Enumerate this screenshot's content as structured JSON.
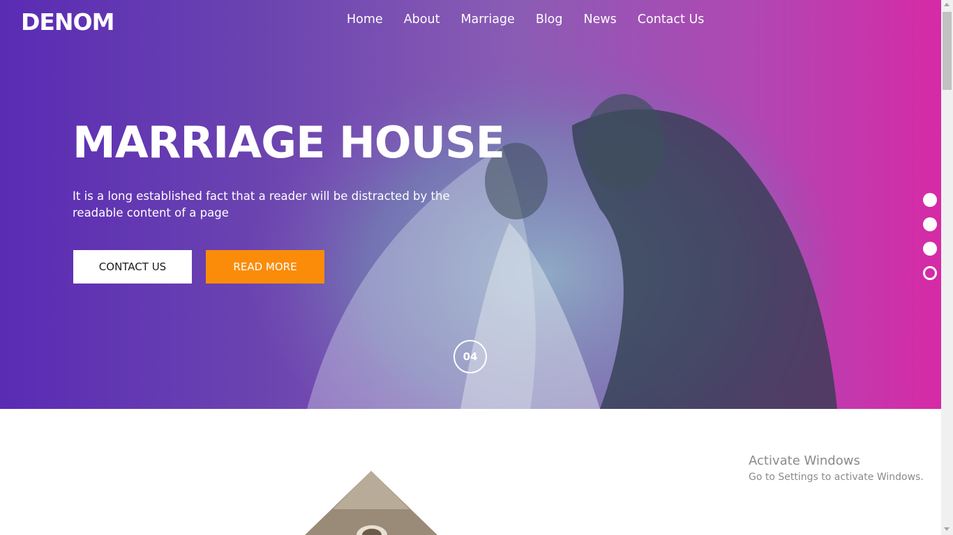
{
  "brand": {
    "logo": "DENOM"
  },
  "nav": {
    "items": [
      "Home",
      "About",
      "Marriage",
      "Blog",
      "News",
      "Contact Us"
    ]
  },
  "hero": {
    "title": "MARRIAGE HOUSE",
    "description": "It is a long established fact that a reader will be distracted by the readable content of a page",
    "contact_button": "CONTACT US",
    "read_more_button": "READ MORE",
    "slide_number": "04",
    "slide_count": 4,
    "active_slide": 4
  },
  "watermark": {
    "title": "Activate Windows",
    "subtitle": "Go to Settings to activate Windows."
  },
  "colors": {
    "gradient_start": "#5a2bb4",
    "gradient_end": "#d62aa6",
    "accent_orange": "#fb8c0a",
    "text_white": "#ffffff"
  }
}
